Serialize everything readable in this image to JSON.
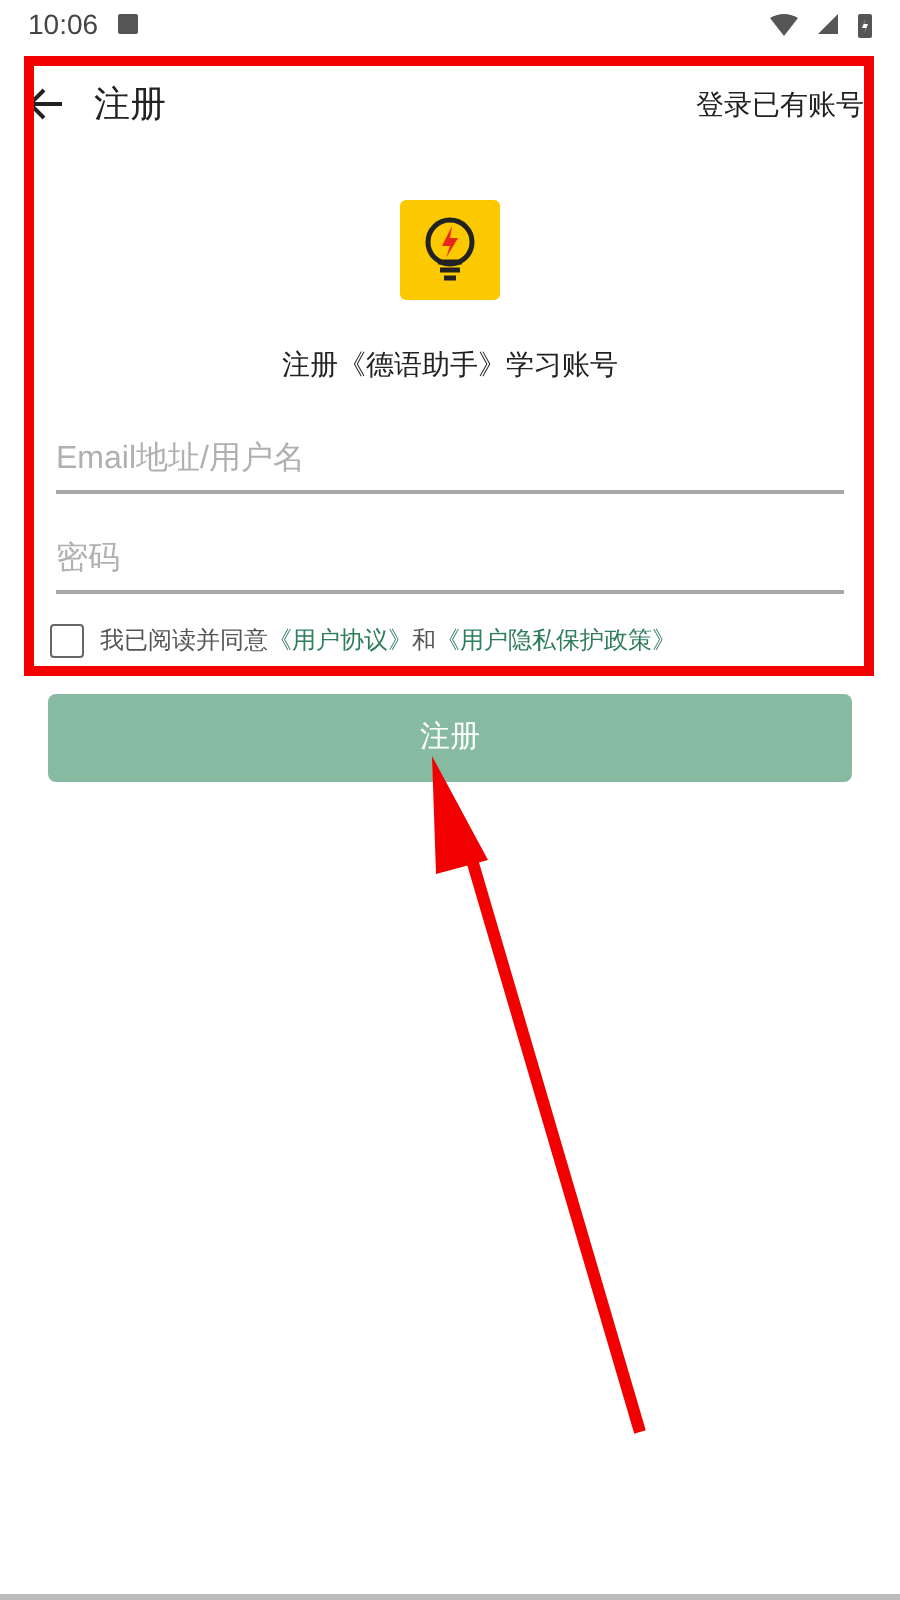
{
  "status_bar": {
    "time": "10:06"
  },
  "header": {
    "title": "注册",
    "action": "登录已有账号"
  },
  "intro": "注册《德语助手》学习账号",
  "fields": [
    {
      "placeholder": "Email地址/用户名"
    },
    {
      "placeholder": "密码"
    }
  ],
  "agreement": {
    "checked": false,
    "parts": [
      {
        "text": "我已阅读并同意",
        "kind": "plain"
      },
      {
        "text": "《用户协议》",
        "kind": "link"
      },
      {
        "text": "和",
        "kind": "plain"
      },
      {
        "text": "《用户隐私保护政策》",
        "kind": "link"
      }
    ]
  },
  "submit": {
    "label": "注册",
    "disabled": true
  }
}
